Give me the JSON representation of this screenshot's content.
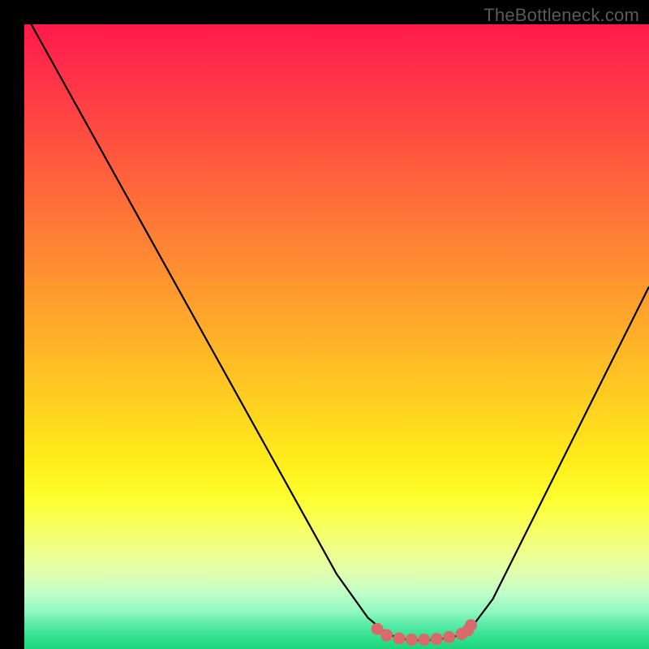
{
  "watermark": "TheBottleneck.com",
  "chart_data": {
    "type": "line",
    "title": "",
    "xlabel": "",
    "ylabel": "",
    "xlim": [
      0,
      100
    ],
    "ylim": [
      0,
      100
    ],
    "grid": false,
    "legend": false,
    "series": [
      {
        "name": "bottleneck-curve",
        "x": [
          0,
          5,
          10,
          15,
          20,
          25,
          30,
          35,
          40,
          45,
          50,
          55,
          58,
          60,
          62,
          64,
          66,
          68,
          70,
          72,
          75,
          80,
          85,
          90,
          95,
          100
        ],
        "y": [
          102,
          93,
          84,
          75,
          66,
          57,
          48,
          39,
          30,
          21,
          12,
          5,
          2.5,
          1.7,
          1.4,
          1.4,
          1.5,
          1.8,
          2.3,
          4,
          8,
          18,
          28,
          38,
          48,
          58
        ]
      }
    ],
    "highlight_points": {
      "name": "minimum-band",
      "x": [
        56.5,
        58,
        60,
        62,
        64,
        66,
        68,
        70,
        71,
        71.5
      ],
      "y": [
        3.2,
        2.2,
        1.7,
        1.5,
        1.5,
        1.6,
        1.9,
        2.4,
        3.0,
        3.8
      ]
    },
    "background_gradient": {
      "top_color": "#ff1a4a",
      "mid_color": "#ffed1a",
      "bottom_color": "#1dd87e"
    }
  }
}
